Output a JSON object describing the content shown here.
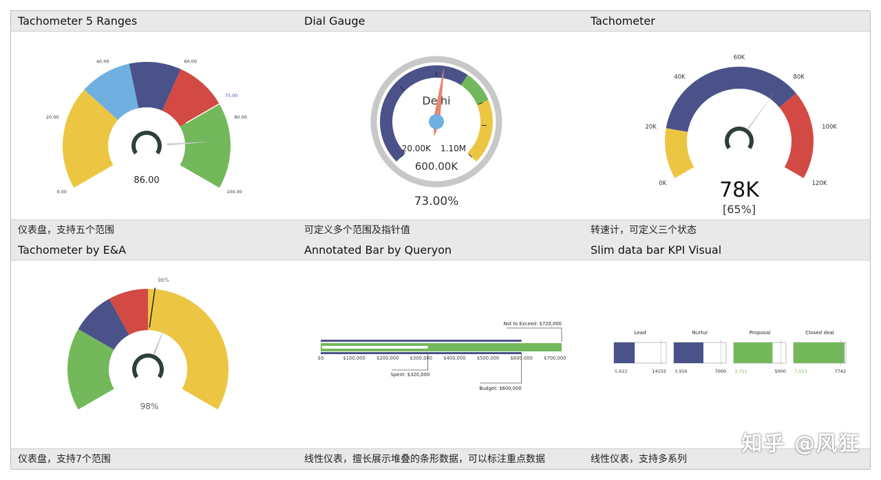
{
  "tiles": [
    {
      "title": "Tachometer 5 Ranges",
      "caption": "仪表盘，支持五个范围"
    },
    {
      "title": "Dial Gauge",
      "caption": "可定义多个范围及指针值"
    },
    {
      "title": "Tachometer",
      "caption": "转速计，可定义三个状态"
    },
    {
      "title": "Tachometer by E&A",
      "caption": "仪表盘，支持7个范围"
    },
    {
      "title": "Annotated Bar by Queryon",
      "caption": "线性仪表，擅长展示堆叠的条形数据，可以标注重点数据"
    },
    {
      "title": "Slim data bar KPI Visual",
      "caption": "线性仪表，支持多系列"
    }
  ],
  "watermark": "知乎 @风狂",
  "colors": {
    "yellow": "#ecc643",
    "lightblue": "#6fb0e1",
    "navy": "#4a5289",
    "red": "#d24a43",
    "green": "#73b85b",
    "dark": "#2f3f3d",
    "gray": "#c8c8c8"
  },
  "chart_data": [
    {
      "type": "gauge",
      "ticks": [
        "0.00",
        "20.00",
        "40.00",
        "60.00",
        "80.00",
        "100.00"
      ],
      "tick_values": [
        0,
        20,
        40,
        60,
        80,
        100
      ],
      "ranges": [
        {
          "from": 0,
          "to": 30,
          "color": "yellow"
        },
        {
          "from": 30,
          "to": 45,
          "color": "lightblue"
        },
        {
          "from": 45,
          "to": 60,
          "color": "navy"
        },
        {
          "from": 60,
          "to": 75,
          "color": "red"
        },
        {
          "from": 75,
          "to": 100,
          "color": "green"
        }
      ],
      "target": 75,
      "target_label": "75.00",
      "value": 86,
      "value_label": "86.00"
    },
    {
      "type": "dial",
      "name": "Delhi",
      "min_label": "20.00K",
      "max_label": "1.10M",
      "value_label": "600.00K",
      "percent_label": "73.00%",
      "needle_fraction": 0.5,
      "bands": [
        {
          "from": 0,
          "to": 0.625,
          "color": "navy"
        },
        {
          "from": 0.625,
          "to": 0.75,
          "color": "green"
        },
        {
          "from": 0.75,
          "to": 1,
          "color": "yellow"
        }
      ]
    },
    {
      "type": "gauge",
      "ticks": [
        "0K",
        "20K",
        "40K",
        "60K",
        "80K",
        "100K",
        "120K"
      ],
      "tick_values": [
        0,
        20,
        40,
        60,
        80,
        100,
        120
      ],
      "ranges": [
        {
          "from": 0,
          "to": 20,
          "color": "yellow"
        },
        {
          "from": 20,
          "to": 85,
          "color": "navy"
        },
        {
          "from": 85,
          "to": 120,
          "color": "red"
        }
      ],
      "value": 78,
      "value_label": "78K",
      "percent_label": "[65%]"
    },
    {
      "type": "gauge",
      "ranges": [
        {
          "from": 0,
          "to": 25,
          "color": "green"
        },
        {
          "from": 25,
          "to": 38,
          "color": "navy"
        },
        {
          "from": 38,
          "to": 50,
          "color": "red"
        },
        {
          "from": 50,
          "to": 100,
          "color": "yellow"
        }
      ],
      "target": 50,
      "target_label": "96%",
      "value": 59,
      "value_label": "98%"
    },
    {
      "type": "bar",
      "axis_ticks": [
        "$0",
        "$100,000",
        "$200,000",
        "$300,000",
        "$400,000",
        "$500,000",
        "$600,000",
        "$700,000"
      ],
      "tick_values": [
        0,
        100000,
        200000,
        300000,
        400000,
        500000,
        600000,
        700000
      ],
      "max": 720000,
      "budget": 600000,
      "spent": 320000,
      "not_to_exceed": 720000,
      "annotations": {
        "not_to_exceed": "Not to Exceed: $720,000",
        "spent": "Spent: $320,000",
        "budget": "Budget: $600,000"
      }
    },
    {
      "type": "bar",
      "series": [
        {
          "name": "Lead",
          "value": 5622,
          "value_label": "5,622",
          "target": 14155,
          "target_label": "14155",
          "color": "navy"
        },
        {
          "name": "Nurtur",
          "value": 3956,
          "value_label": "3,956",
          "target": 7000,
          "target_label": "7000",
          "color": "navy"
        },
        {
          "name": "Proposal",
          "value": 3711,
          "value_label": "3,711",
          "target": 5000,
          "target_label": "5000",
          "color": "green"
        },
        {
          "name": "Closed deal",
          "value": 7553,
          "value_label": "7,553",
          "target": 7742,
          "target_label": "7742",
          "color": "green"
        }
      ]
    }
  ]
}
